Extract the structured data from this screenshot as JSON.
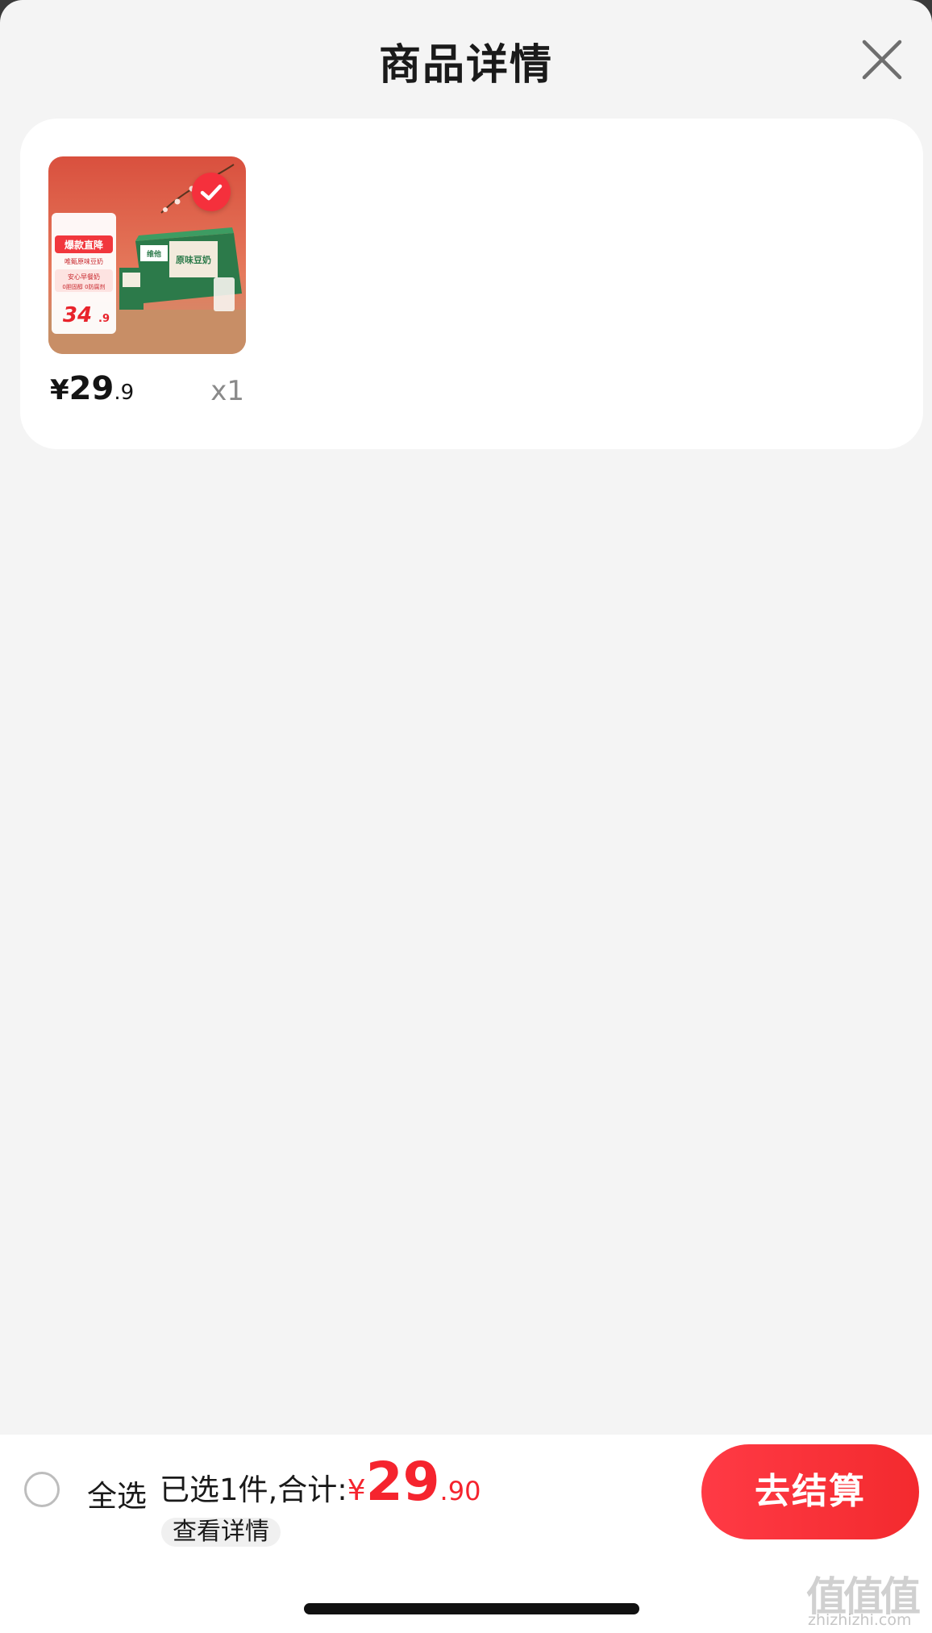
{
  "header": {
    "title": "商品详情",
    "close_icon": "close-icon"
  },
  "product": {
    "image_icon": "product-image",
    "selected": true,
    "image_text": {
      "banner": "爆款直降",
      "subtitle": "唯甄原味豆奶",
      "tagline_1": "安心早餐奶",
      "tagline_2": "0胆固醇 0防腐剂",
      "old_price": "34",
      "old_price_dec": ".9",
      "brand": "维他",
      "product_name": "原味豆奶"
    },
    "price_symbol": "¥",
    "price_int": "29",
    "price_dec": ".9",
    "quantity": "x1"
  },
  "bottom_bar": {
    "select_all_label": "全选",
    "summary_label": "已选1件,合计:",
    "currency": "¥",
    "total_int": "29",
    "total_dec": ".90",
    "detail_link": "查看详情",
    "checkout_label": "去结算"
  },
  "watermark": {
    "glyphs": "值值值",
    "url": "zhizhizhi.com"
  },
  "colors": {
    "accent": "#f5242e",
    "background": "#f4f4f4",
    "card": "#ffffff"
  }
}
